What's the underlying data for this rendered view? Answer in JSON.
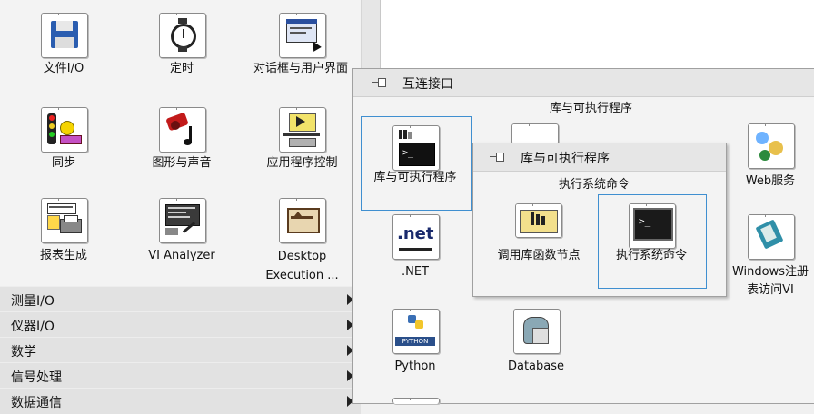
{
  "palette": {
    "tiles": [
      {
        "label": "文件I/O"
      },
      {
        "label": "定时"
      },
      {
        "label": "对话框与用户界面"
      },
      {
        "label": "同步"
      },
      {
        "label": "图形与声音"
      },
      {
        "label": "应用程序控制"
      },
      {
        "label": "报表生成"
      },
      {
        "label": "VI Analyzer"
      },
      {
        "label": "Desktop Execution ..."
      }
    ],
    "categories": [
      {
        "label": "测量I/O"
      },
      {
        "label": "仪器I/O"
      },
      {
        "label": "数学"
      },
      {
        "label": "信号处理"
      },
      {
        "label": "数据通信"
      }
    ]
  },
  "submenu1": {
    "title": "互连接口",
    "section_label": "库与可执行程序",
    "tiles": [
      {
        "label": "库与可执行程序"
      },
      {
        "label": "Web服务"
      },
      {
        "label": ".NET"
      },
      {
        "label": "Windows注册表访问VI"
      },
      {
        "label": "Python"
      },
      {
        "label": "Database"
      }
    ]
  },
  "submenu2": {
    "title": "库与可执行程序",
    "section_label": "执行系统命令",
    "tiles": [
      {
        "label": "调用库函数节点"
      },
      {
        "label": "执行系统命令"
      }
    ]
  },
  "icon_text": {
    "net": ".net",
    "python": "PYTHON",
    "cmd": ">_"
  }
}
